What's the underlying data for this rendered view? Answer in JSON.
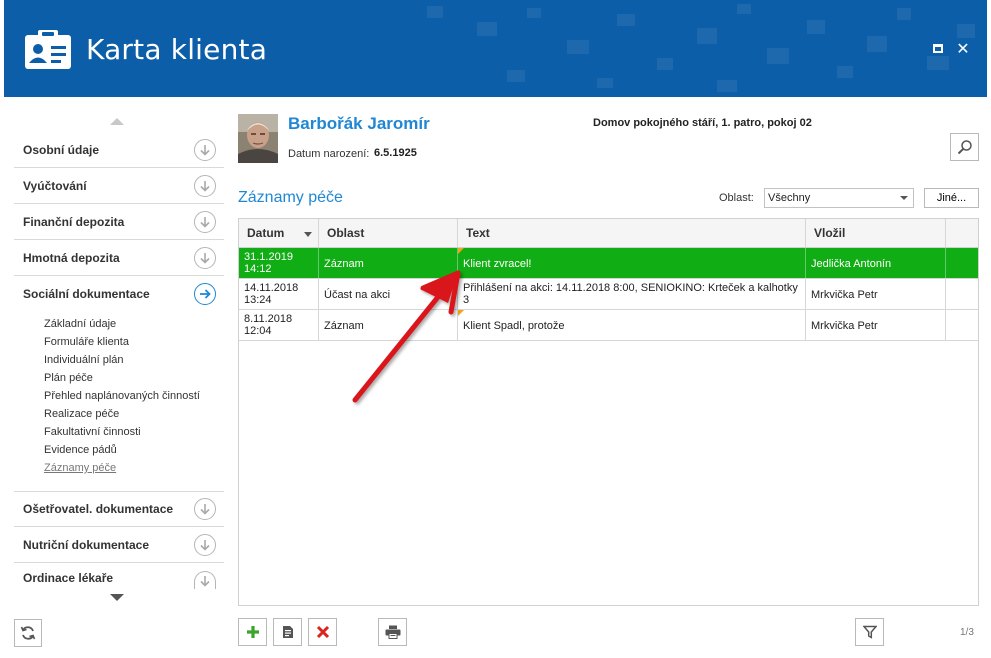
{
  "window": {
    "title": "Karta klienta",
    "icons": {
      "app": "id-card-icon",
      "maximize": "maximize-icon",
      "close": "close-icon"
    },
    "close_glyph": "✕"
  },
  "colors": {
    "header": "#0d5ea8",
    "accent": "#1f87d3",
    "selected_row": "#11ad14",
    "note_mark": "#f0a31a",
    "annotation_arrow": "#d8141c"
  },
  "sidebar": {
    "sections": [
      {
        "label": "Osobní údaje",
        "icon": "arrow-down-circle-icon"
      },
      {
        "label": "Vyúčtování",
        "icon": "arrow-down-circle-icon"
      },
      {
        "label": "Finanční depozita",
        "icon": "arrow-down-circle-icon"
      },
      {
        "label": "Hmotná depozita",
        "icon": "arrow-down-circle-icon"
      },
      {
        "label": "Sociální dokumentace",
        "icon": "arrow-right-circle-icon",
        "active": true
      },
      {
        "label": "Ošetřovatel. dokumentace",
        "icon": "arrow-down-circle-icon"
      },
      {
        "label": "Nutriční dokumentace",
        "icon": "arrow-down-circle-icon"
      },
      {
        "label": "Ordinace lékaře",
        "icon": "arrow-down-circle-icon"
      }
    ],
    "sub_items": [
      "Základní údaje",
      "Formuláře klienta",
      "Individuální plán",
      "Plán péče",
      "Přehled naplánovaných činností",
      "Realizace péče",
      "Fakultativní činnosti",
      "Evidence pádů",
      "Záznamy péče"
    ],
    "current_sub_item": "Záznamy péče",
    "refresh_icon": "refresh-icon"
  },
  "client": {
    "name": "Barbořák Jaromír",
    "dob_label": "Datum narození:",
    "dob": "6.5.1925",
    "location": "Domov pokojného stáří, 1. patro, pokoj 02",
    "search_icon": "search-icon"
  },
  "records": {
    "title": "Záznamy péče",
    "filter_label": "Oblast:",
    "filter_value": "Všechny",
    "other_button": "Jiné...",
    "columns": [
      "Datum",
      "Oblast",
      "Text",
      "Vložil"
    ],
    "sort_column": "Datum",
    "rows": [
      {
        "date": "31.1.2019",
        "time": "14:12",
        "area": "Záznam",
        "text": "Klient zvracel!",
        "author": "Jedlička Antonín",
        "selected": true,
        "note": true
      },
      {
        "date": "14.11.2018",
        "time": "13:24",
        "area": "Účast na akci",
        "text": "Přihlášení na akci: 14.11.2018 8:00, SENIOKINO: Krteček a kalhotky 3",
        "author": "Mrkvička Petr",
        "selected": false,
        "note": false
      },
      {
        "date": "8.11.2018",
        "time": "12:04",
        "area": "Záznam",
        "text": "Klient Spadl, protože",
        "author": "Mrkvička Petr",
        "selected": false,
        "note": true
      }
    ]
  },
  "toolbar": {
    "buttons": [
      {
        "name": "add-button",
        "icon": "plus-icon"
      },
      {
        "name": "edit-button",
        "icon": "document-icon"
      },
      {
        "name": "delete-button",
        "icon": "delete-x-icon"
      },
      {
        "name": "print-button",
        "icon": "printer-icon"
      }
    ],
    "filter_icon": "filter-icon",
    "pager": "1/3"
  }
}
